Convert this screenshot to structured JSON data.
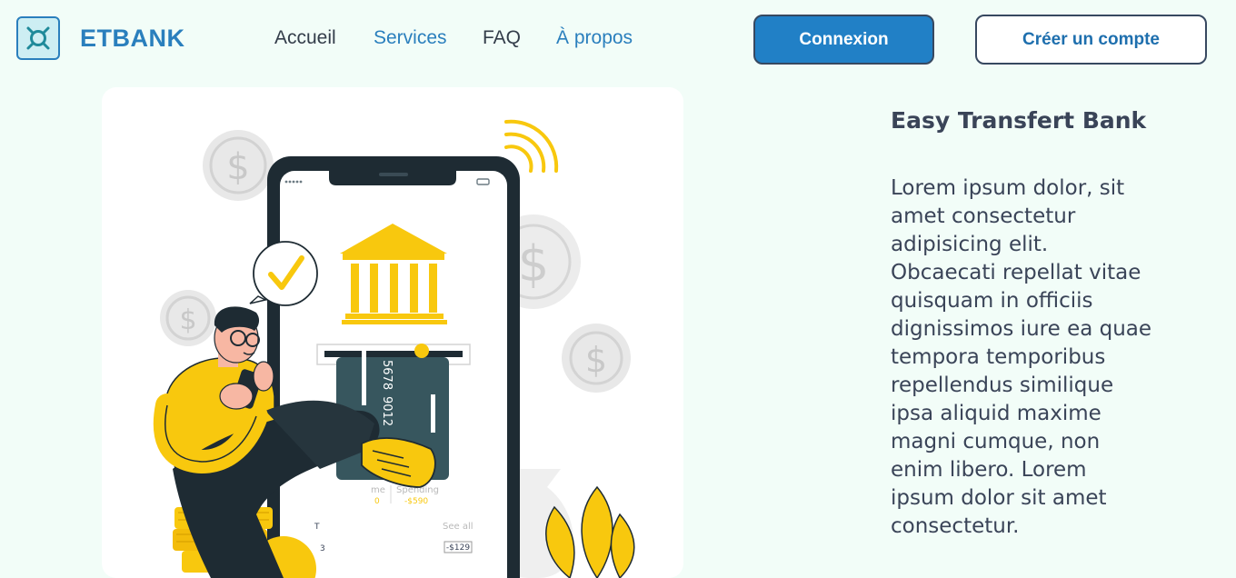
{
  "brand": {
    "name": "ETBANK"
  },
  "nav": {
    "links": [
      {
        "label": "Accueil"
      },
      {
        "label": "Services"
      },
      {
        "label": "FAQ"
      },
      {
        "label": "À propos"
      }
    ],
    "login_label": "Connexion",
    "signup_label": "Créer un compte"
  },
  "hero": {
    "title": "Easy Transfert Bank",
    "text": "Lorem ipsum dolor, sit amet consectetur adipisicing elit. Obcaecati repellat vitae quisquam in officiis dignissimos iure ea quae tempora temporibus repellendus similique ipsa aliquid maxime magni cumque, non enim libero. Lorem ipsum dolor sit amet consectetur.",
    "illustration": {
      "card_number_1": "5678",
      "card_number_2": "9012",
      "spending_label": "Spending",
      "spending_value": "-$590",
      "income_prefix": "me",
      "income_value": "0",
      "see_all": "See all",
      "row_value": "-$129",
      "row_label_1": "T",
      "row_label_2": "3",
      "dollar_symbol": "$"
    }
  },
  "colors": {
    "accent": "#2a7fbd",
    "button_primary": "#2180c6",
    "yellow": "#f8c80e",
    "phone_dark": "#1e2b33",
    "background": "#f2fdf8"
  }
}
